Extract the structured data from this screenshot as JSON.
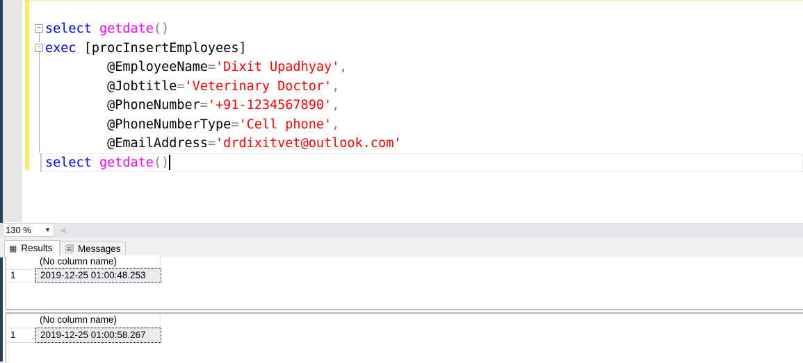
{
  "editor": {
    "lines": [
      {
        "tokens": [
          {
            "t": "select",
            "c": "kw"
          },
          {
            "t": " ",
            "c": "id"
          },
          {
            "t": "getdate",
            "c": "fn"
          },
          {
            "t": "()",
            "c": "op"
          }
        ]
      },
      {
        "tokens": [
          {
            "t": "exec",
            "c": "kw"
          },
          {
            "t": " [procInsertEmployees]",
            "c": "id"
          }
        ]
      },
      {
        "tokens": [
          {
            "t": "        @EmployeeName",
            "c": "id"
          },
          {
            "t": "=",
            "c": "op"
          },
          {
            "t": "'Dixit Upadhyay'",
            "c": "str"
          },
          {
            "t": ",",
            "c": "op"
          }
        ]
      },
      {
        "tokens": [
          {
            "t": "        @Jobtitle",
            "c": "id"
          },
          {
            "t": "=",
            "c": "op"
          },
          {
            "t": "'Veterinary Doctor'",
            "c": "str"
          },
          {
            "t": ",",
            "c": "op"
          }
        ]
      },
      {
        "tokens": [
          {
            "t": "        @PhoneNumber",
            "c": "id"
          },
          {
            "t": "=",
            "c": "op"
          },
          {
            "t": "'+91-1234567890'",
            "c": "str"
          },
          {
            "t": ",",
            "c": "op"
          }
        ]
      },
      {
        "tokens": [
          {
            "t": "        @PhoneNumberType",
            "c": "id"
          },
          {
            "t": "=",
            "c": "op"
          },
          {
            "t": "'Cell phone'",
            "c": "str"
          },
          {
            "t": ",",
            "c": "op"
          }
        ]
      },
      {
        "tokens": [
          {
            "t": "        @EmailAddress",
            "c": "id"
          },
          {
            "t": "=",
            "c": "op"
          },
          {
            "t": "'drdixitvet@outlook.com'",
            "c": "str"
          }
        ]
      },
      {
        "tokens": [
          {
            "t": "select",
            "c": "kw"
          },
          {
            "t": " ",
            "c": "id"
          },
          {
            "t": "getdate",
            "c": "fn"
          },
          {
            "t": "()",
            "c": "op"
          }
        ],
        "caret": true
      }
    ]
  },
  "zoom": {
    "value": "130 %",
    "icon": "chevron-down-icon"
  },
  "tabs": {
    "results": {
      "label": "Results",
      "icon": "grid-icon"
    },
    "messages": {
      "label": "Messages",
      "icon": "messages-icon"
    }
  },
  "results": [
    {
      "column_header": "(No column name)",
      "rows": [
        {
          "num": "1",
          "value": "2019-12-25 01:00:48.253"
        }
      ]
    },
    {
      "column_header": "(No column name)",
      "rows": [
        {
          "num": "1",
          "value": "2019-12-25 01:00:58.267"
        }
      ]
    }
  ]
}
